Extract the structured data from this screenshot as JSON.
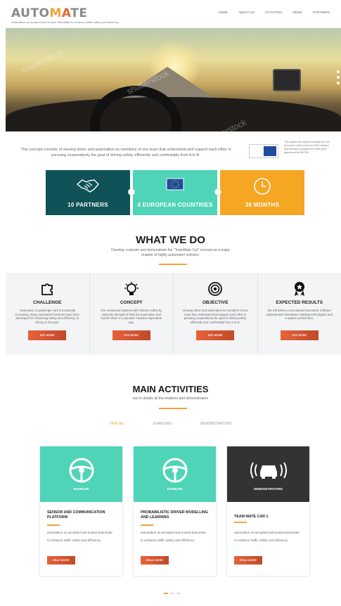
{
  "header": {
    "logo_prefix": "AUTO",
    "logo_mid1": "M",
    "logo_mid2": "A",
    "logo_suffix": "TE",
    "tagline": "Automation as accepted and trusted TeamMate to enhance traffic safety and efficiency",
    "nav": [
      "HOME",
      "ABOUT US",
      "ACTIVITIES",
      "NEWS",
      "PARTNERS"
    ]
  },
  "hero": {
    "watermark": "shutterstock"
  },
  "concept": {
    "text": "This concept consists of viewing driver and automation as members of one team that understand and support each other in pursuing cooperatively the goal of driving safely, efficiently and comfortably from A to B.",
    "eu_text": "This project has received funding from the European Union's Horizon 2020 research and innovation programme under grant agreement No 690705"
  },
  "stats": [
    {
      "label": "10 PARTNERS",
      "color": "#0f5257",
      "icon": "handshake-icon"
    },
    {
      "label": "4 EUROPEAN COUNTRIES",
      "color": "#4fd4b8",
      "icon": "eu-flag-icon"
    },
    {
      "label": "36 MONTHS",
      "color": "#f5a623",
      "icon": "clock-icon"
    }
  ],
  "what_we_do": {
    "title": "WHAT WE DO",
    "subtitle": "Develop, evaluate and demonstrate the \"TeamMate Car\" concept as a major enabler of highly automated vehicles.",
    "items": [
      {
        "title": "CHALLENGE",
        "desc": "Automation in passenger cars is constantly increasing. Many automated functions have been developed for enhancing safety and efficiency of driving in the past.",
        "button": "SEE MORE",
        "icon": "puzzle-icon"
      },
      {
        "title": "CONCEPT",
        "desc": "Our envisioned systems will enhance safety by using the strength of both the automation and human driver in a dynamic situation dependent way.",
        "button": "SEE MORE",
        "icon": "bulb-icon"
      },
      {
        "title": "OBJECTIVE",
        "desc": "Viewing driver and automation as members of one team that understand and support each other in pursuing cooperatively the goal of driving safely, efficiently and comfortably from A to B.",
        "button": "SEE MORE",
        "icon": "target-icon"
      },
      {
        "title": "EXPECTED RESULTS",
        "desc": "We will deliver a conceptual framework, software implemented TeamMate enabling technologies and a system architecture.",
        "button": "SEE MORE",
        "icon": "award-icon"
      }
    ]
  },
  "main_activities": {
    "title": "MAIN ACTIVITIES",
    "subtitle": "see in details all the enablers and demonstrators",
    "filters": [
      "VIEW ALL",
      "ENABLERS",
      "DEMONSTRATORS"
    ],
    "active_filter": "VIEW ALL",
    "cards": [
      {
        "tag": "ENABLER",
        "title": "SENSOR AND COMMUNICATION PLATFORM",
        "text": "automation as accepted and trusted teammate to enhance traffic safety and efficiency",
        "button": "READ MORE",
        "color": "#4fd4b8",
        "icon": "steering-wheel-icon"
      },
      {
        "tag": "ENABLER",
        "title": "PROBABILISTIC DRIVER MODELLING AND LEARNING",
        "text": "automation as accepted and trusted teammate to enhance traffic safety and efficiency",
        "button": "READ MORE",
        "color": "#4fd4b8",
        "icon": "steering-wheel-icon"
      },
      {
        "tag": "DEMONSTRATORS",
        "title": "TEAM MATE CAR 1",
        "text": "automation as accepted and trusted teammate to enhance traffic safety and efficiency",
        "button": "READ MORE",
        "color": "#333333",
        "icon": "car-signal-icon"
      }
    ]
  }
}
